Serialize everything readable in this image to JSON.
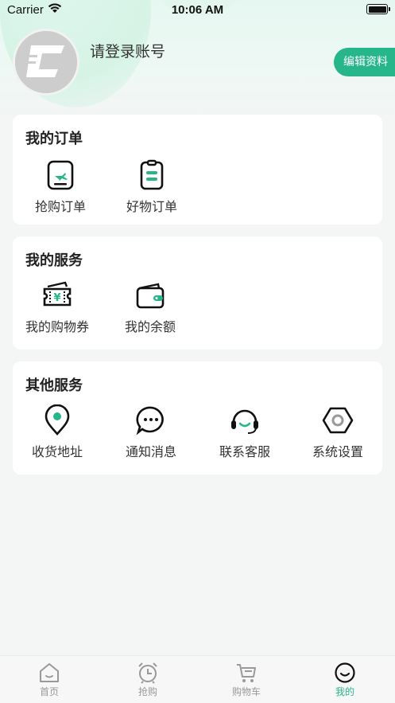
{
  "status_bar": {
    "carrier": "Carrier",
    "time": "10:06 AM"
  },
  "profile": {
    "login_text": "请登录账号",
    "edit_button": "编辑资料"
  },
  "orders": {
    "title": "我的订单",
    "items": [
      {
        "label": "抢购订单",
        "icon": "flash-sale-order-icon"
      },
      {
        "label": "好物订单",
        "icon": "goods-order-icon"
      }
    ]
  },
  "services": {
    "title": "我的服务",
    "items": [
      {
        "label": "我的购物券",
        "icon": "coupon-icon"
      },
      {
        "label": "我的余额",
        "icon": "wallet-icon"
      }
    ]
  },
  "other": {
    "title": "其他服务",
    "items": [
      {
        "label": "收货地址",
        "icon": "location-pin-icon"
      },
      {
        "label": "通知消息",
        "icon": "message-bubble-icon"
      },
      {
        "label": "联系客服",
        "icon": "headset-icon"
      },
      {
        "label": "系统设置",
        "icon": "settings-hexagon-icon"
      }
    ]
  },
  "tabbar": {
    "tabs": [
      {
        "label": "首页",
        "icon": "home-icon",
        "active": false
      },
      {
        "label": "抢购",
        "icon": "alarm-clock-icon",
        "active": false
      },
      {
        "label": "购物车",
        "icon": "cart-icon",
        "active": false
      },
      {
        "label": "我的",
        "icon": "smile-face-icon",
        "active": true
      }
    ]
  },
  "colors": {
    "accent": "#27b58a",
    "background": "#f4f5f5",
    "inactive_tab": "#999999"
  }
}
